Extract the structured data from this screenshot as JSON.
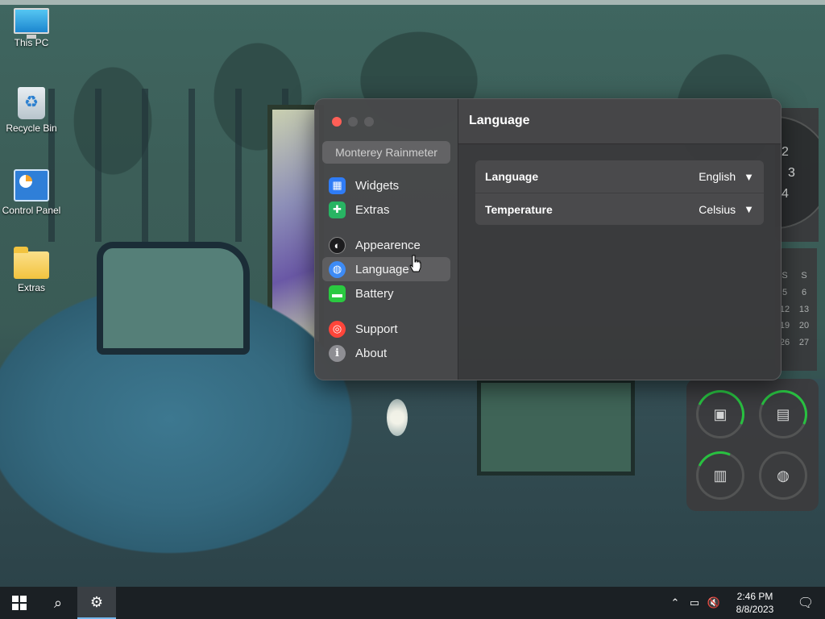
{
  "desktop": {
    "icons": [
      {
        "label": "This PC"
      },
      {
        "label": "Recycle Bin"
      },
      {
        "label": "Control Panel"
      },
      {
        "label": "Extras"
      }
    ]
  },
  "app": {
    "title": "Monterey Rainmeter",
    "nav": [
      {
        "label": "Widgets",
        "icon": "widgets-icon"
      },
      {
        "label": "Extras",
        "icon": "extras-icon"
      },
      {
        "label": "Appearence",
        "icon": "appearance-icon"
      },
      {
        "label": "Language",
        "icon": "globe-icon",
        "active": true
      },
      {
        "label": "Battery",
        "icon": "battery-icon"
      },
      {
        "label": "Support",
        "icon": "lifebuoy-icon"
      },
      {
        "label": "About",
        "icon": "info-icon"
      }
    ],
    "header": "Language",
    "settings": [
      {
        "label": "Language",
        "value": "English"
      },
      {
        "label": "Temperature",
        "value": "Celsius"
      }
    ]
  },
  "widgets": {
    "clock_numbers": [
      "2",
      "3",
      "4"
    ],
    "calendar": {
      "header": [
        "S",
        "S"
      ],
      "rows": [
        [
          "5",
          "6"
        ],
        [
          "12",
          "13"
        ],
        [
          "19",
          "20"
        ],
        [
          "26",
          "27"
        ]
      ]
    }
  },
  "taskbar": {
    "time": "2:46 PM",
    "date": "8/8/2023"
  },
  "colors": {
    "accent_green": "#28c840",
    "close_red": "#ff5f57",
    "taskbar": "#1b2024"
  }
}
